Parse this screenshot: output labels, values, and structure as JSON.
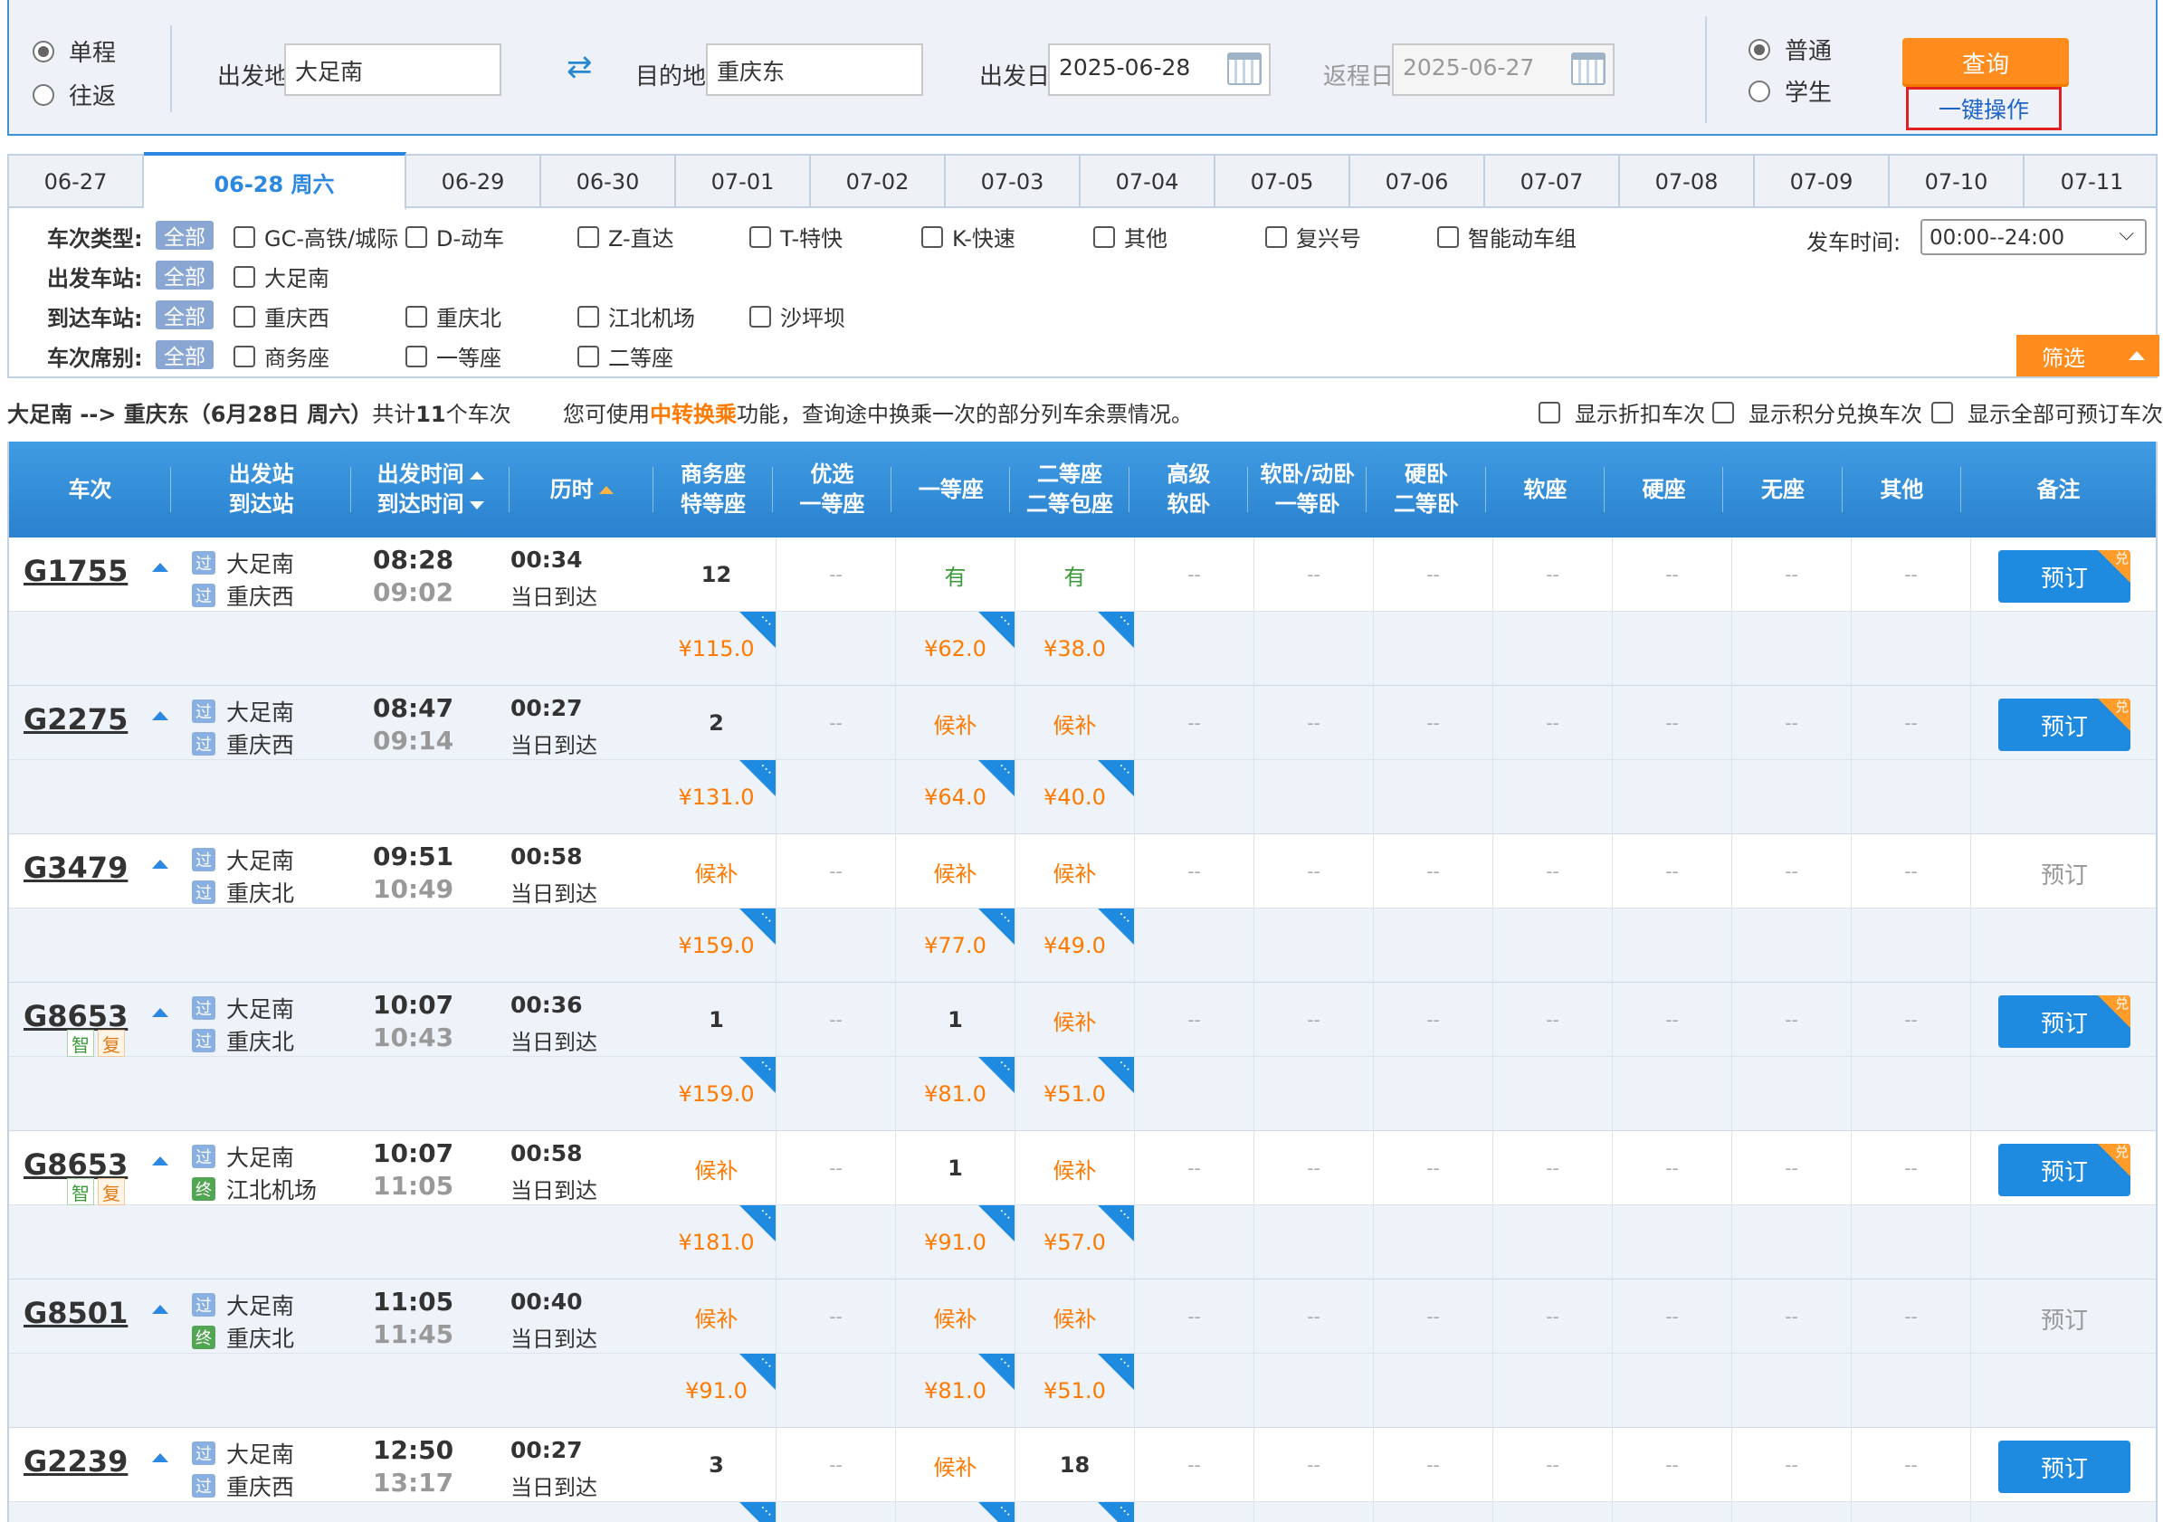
{
  "search": {
    "trip_type": [
      {
        "label": "单程",
        "checked": true
      },
      {
        "label": "往返",
        "checked": false
      }
    ],
    "from_label": "出发地",
    "from_value": "大足南",
    "to_label": "目的地",
    "to_value": "重庆东",
    "depart_label": "出发日",
    "depart_value": "2025-06-28",
    "return_label": "返程日",
    "return_value": "2025-06-27",
    "passenger_type": [
      {
        "label": "普通",
        "checked": true
      },
      {
        "label": "学生",
        "checked": false
      }
    ],
    "query_label": "查询",
    "onekey_label": "一键操作"
  },
  "date_tabs": [
    {
      "label": "06-27",
      "active": false
    },
    {
      "label": "06-28 周六",
      "active": true
    },
    {
      "label": "06-29",
      "active": false
    },
    {
      "label": "06-30",
      "active": false
    },
    {
      "label": "07-01",
      "active": false
    },
    {
      "label": "07-02",
      "active": false
    },
    {
      "label": "07-03",
      "active": false
    },
    {
      "label": "07-04",
      "active": false
    },
    {
      "label": "07-05",
      "active": false
    },
    {
      "label": "07-06",
      "active": false
    },
    {
      "label": "07-07",
      "active": false
    },
    {
      "label": "07-08",
      "active": false
    },
    {
      "label": "07-09",
      "active": false
    },
    {
      "label": "07-10",
      "active": false
    },
    {
      "label": "07-11",
      "active": false
    }
  ],
  "filters": {
    "all_label": "全部",
    "train_type": {
      "label": "车次类型:",
      "options": [
        "GC-高铁/城际",
        "D-动车",
        "Z-直达",
        "T-特快",
        "K-快速",
        "其他",
        "复兴号",
        "智能动车组"
      ]
    },
    "dep_station": {
      "label": "出发车站:",
      "options": [
        "大足南"
      ]
    },
    "arr_station": {
      "label": "到达车站:",
      "options": [
        "重庆西",
        "重庆北",
        "江北机场",
        "沙坪坝"
      ]
    },
    "seat_class": {
      "label": "车次席别:",
      "options": [
        "商务座",
        "一等座",
        "二等座"
      ]
    },
    "dep_time_label": "发车时间:",
    "dep_time_value": "00:00--24:00",
    "filter_button": "筛选"
  },
  "summary": {
    "route": "大足南 --> 重庆东",
    "date_text": "（6月28日  周六）",
    "count_prefix": "共计",
    "count": "11",
    "count_suffix": "个车次",
    "note_prefix": "您可使用",
    "note_highlight": "中转换乘",
    "note_suffix": "功能，查询途中换乘一次的部分列车余票情况。",
    "options": [
      "显示折扣车次",
      "显示积分兑换车次",
      "显示全部可预订车次"
    ]
  },
  "columns": {
    "train": "车次",
    "stations_1": "出发站",
    "stations_2": "到达站",
    "time_1": "出发时间",
    "time_2": "到达时间",
    "duration": "历时",
    "business_1": "商务座",
    "business_2": "特等座",
    "premium_1": "优选",
    "premium_2": "一等座",
    "first": "一等座",
    "second_1": "二等座",
    "second_2": "二等包座",
    "deluxe_1": "高级",
    "deluxe_2": "软卧",
    "soft_1": "软卧/动卧",
    "soft_2": "一等卧",
    "hard_1": "硬卧",
    "hard_2": "二等卧",
    "soft_seat": "软座",
    "hard_seat": "硬座",
    "no_seat": "无座",
    "other": "其他",
    "remark": "备注"
  },
  "trains": [
    {
      "no": "G1755",
      "from": "大足南",
      "from_tag": "过",
      "to": "重庆西",
      "to_tag": "过",
      "dep": "08:28",
      "arr": "09:02",
      "dur": "00:34",
      "day": "当日到达",
      "business": "12",
      "premium": "--",
      "first": "有",
      "second": "有",
      "others": "--",
      "price_business": "¥115.0",
      "price_first": "¥62.0",
      "price_second": "¥38.0",
      "book": "预订",
      "bookable": true,
      "dui": "兑",
      "badges": []
    },
    {
      "no": "G2275",
      "from": "大足南",
      "from_tag": "过",
      "to": "重庆西",
      "to_tag": "过",
      "dep": "08:47",
      "arr": "09:14",
      "dur": "00:27",
      "day": "当日到达",
      "business": "2",
      "premium": "--",
      "first": "候补",
      "second": "候补",
      "others": "--",
      "price_business": "¥131.0",
      "price_first": "¥64.0",
      "price_second": "¥40.0",
      "book": "预订",
      "bookable": true,
      "dui": "兑",
      "badges": []
    },
    {
      "no": "G3479",
      "from": "大足南",
      "from_tag": "过",
      "to": "重庆北",
      "to_tag": "过",
      "dep": "09:51",
      "arr": "10:49",
      "dur": "00:58",
      "day": "当日到达",
      "business": "候补",
      "premium": "--",
      "first": "候补",
      "second": "候补",
      "others": "--",
      "price_business": "¥159.0",
      "price_first": "¥77.0",
      "price_second": "¥49.0",
      "book": "预订",
      "bookable": false,
      "dui": "",
      "badges": []
    },
    {
      "no": "G8653",
      "from": "大足南",
      "from_tag": "过",
      "to": "重庆北",
      "to_tag": "过",
      "dep": "10:07",
      "arr": "10:43",
      "dur": "00:36",
      "day": "当日到达",
      "business": "1",
      "premium": "--",
      "first": "1",
      "second": "候补",
      "others": "--",
      "price_business": "¥159.0",
      "price_first": "¥81.0",
      "price_second": "¥51.0",
      "book": "预订",
      "bookable": true,
      "dui": "兑",
      "badges": [
        "智",
        "复"
      ]
    },
    {
      "no": "G8653",
      "from": "大足南",
      "from_tag": "过",
      "to": "江北机场",
      "to_tag": "终",
      "dep": "10:07",
      "arr": "11:05",
      "dur": "00:58",
      "day": "当日到达",
      "business": "候补",
      "premium": "--",
      "first": "1",
      "second": "候补",
      "others": "--",
      "price_business": "¥181.0",
      "price_first": "¥91.0",
      "price_second": "¥57.0",
      "book": "预订",
      "bookable": true,
      "dui": "兑",
      "badges": [
        "智",
        "复"
      ]
    },
    {
      "no": "G8501",
      "from": "大足南",
      "from_tag": "过",
      "to": "重庆北",
      "to_tag": "终",
      "dep": "11:05",
      "arr": "11:45",
      "dur": "00:40",
      "day": "当日到达",
      "business": "候补",
      "premium": "--",
      "first": "候补",
      "second": "候补",
      "others": "--",
      "price_business": "¥91.0",
      "price_first": "¥81.0",
      "price_second": "¥51.0",
      "book": "预订",
      "bookable": false,
      "dui": "",
      "badges": []
    },
    {
      "no": "G2239",
      "from": "大足南",
      "from_tag": "过",
      "to": "重庆西",
      "to_tag": "过",
      "dep": "12:50",
      "arr": "13:17",
      "dur": "00:27",
      "day": "当日到达",
      "business": "3",
      "premium": "--",
      "first": "候补",
      "second": "18",
      "others": "--",
      "price_business": "",
      "price_first": "",
      "price_second": "",
      "book": "预订",
      "bookable": true,
      "dui": "",
      "badges": []
    }
  ],
  "colors": {
    "accent": "#2c87e0",
    "orange": "#ff8c1c",
    "green": "#3a9a3a"
  }
}
